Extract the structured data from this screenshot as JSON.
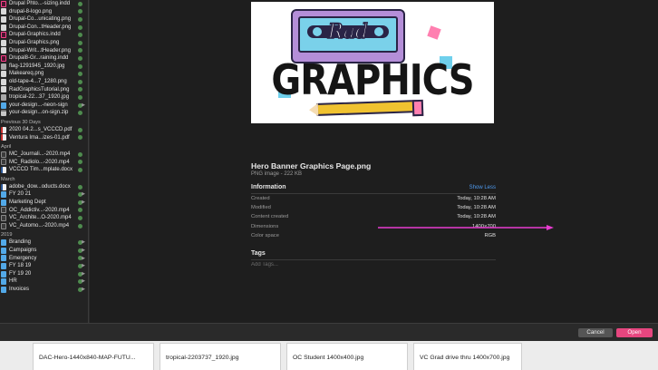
{
  "sidebar": {
    "recent": [
      {
        "name": "Drupal Phto...-sizing.indd",
        "type": "indd"
      },
      {
        "name": "drupal-8-logo.png",
        "type": "png"
      },
      {
        "name": "Drupal-Co...unicating.png",
        "type": "png"
      },
      {
        "name": "Drupal-Con...tHeader.png",
        "type": "png"
      },
      {
        "name": "Drupal-Graphics.indd",
        "type": "indd"
      },
      {
        "name": "Drupal-Graphics.png",
        "type": "png"
      },
      {
        "name": "Drupal-Writ...tHeader.png",
        "type": "png"
      },
      {
        "name": "Drupal8-Gr...raining.indd",
        "type": "indd"
      },
      {
        "name": "flag-1291945_1920.jpg",
        "type": "jpg"
      },
      {
        "name": "Makeareq.png",
        "type": "png"
      },
      {
        "name": "old-tape-4...7_1280.png",
        "type": "png"
      },
      {
        "name": "RadGraphicsTutorial.png",
        "type": "png"
      },
      {
        "name": "tropical-22...37_1920.jpg",
        "type": "jpg"
      },
      {
        "name": "your-design...-neon-sign",
        "type": "folder",
        "chevron": true
      },
      {
        "name": "your-design...on-sign.zip",
        "type": "zip"
      }
    ],
    "prev30_label": "Previous 30 Days",
    "prev30": [
      {
        "name": "2020 04.2...s_VCCCD.pdf",
        "type": "pdf"
      },
      {
        "name": "Ventura Ima...izes-01.pdf",
        "type": "pdf"
      }
    ],
    "april_label": "April",
    "april": [
      {
        "name": "MC_Journali...-2020.mp4",
        "type": "mp4"
      },
      {
        "name": "MC_Radiolo...-2020.mp4",
        "type": "mp4"
      },
      {
        "name": "VCCCD Tim...mplate.docx",
        "type": "docx"
      }
    ],
    "march_label": "March",
    "march": [
      {
        "name": "adobe_dow...oducts.docx",
        "type": "docx"
      },
      {
        "name": "FY 20 21",
        "type": "folder",
        "chevron": true
      },
      {
        "name": "Marketing Dept",
        "type": "folder",
        "chevron": true
      },
      {
        "name": "OC_Addictiv...-2020.mp4",
        "type": "mp4"
      },
      {
        "name": "VC_Archite...O-2020.mp4",
        "type": "mp4"
      },
      {
        "name": "VC_Automo...-2020.mp4",
        "type": "mp4"
      }
    ],
    "y2019_label": "2019",
    "y2019": [
      {
        "name": "Branding",
        "type": "folder",
        "chevron": true
      },
      {
        "name": "Campaigns",
        "type": "folder",
        "chevron": true
      },
      {
        "name": "Emergency",
        "type": "folder",
        "chevron": true
      },
      {
        "name": "FY 18 19",
        "type": "folder",
        "chevron": true
      },
      {
        "name": "FY 19 20",
        "type": "folder",
        "chevron": true
      },
      {
        "name": "HR",
        "type": "folder",
        "chevron": true
      },
      {
        "name": "Invoices",
        "type": "folder",
        "chevron": true
      }
    ]
  },
  "preview": {
    "image_text_rad": "Rad",
    "image_text_graphics": "GRAPHICS",
    "file_title": "Hero Banner Graphics Page.png",
    "file_sub": "PNG image - 222 KB"
  },
  "info": {
    "title": "Information",
    "show_less": "Show Less",
    "rows": [
      {
        "k": "Created",
        "v": "Today, 10:28 AM"
      },
      {
        "k": "Modified",
        "v": "Today, 10:28 AM"
      },
      {
        "k": "Content created",
        "v": "Today, 10:28 AM"
      },
      {
        "k": "Dimensions",
        "v": "1400×700"
      },
      {
        "k": "Color space",
        "v": "RGB"
      }
    ],
    "arrow_color": "#e83cd0"
  },
  "tags": {
    "title": "Tags",
    "placeholder": "Add Tags..."
  },
  "buttons": {
    "cancel": "Cancel",
    "open": "Open",
    "accent": "#e6467f"
  },
  "grid": {
    "thumbs": [
      "DAC-Hero-1440x840-MAP-FUTU...",
      "tropical-2203737_1920.jpg",
      "OC Student 1400x400.jpg",
      "VC Grad drive thru 1400x700.jpg"
    ]
  }
}
